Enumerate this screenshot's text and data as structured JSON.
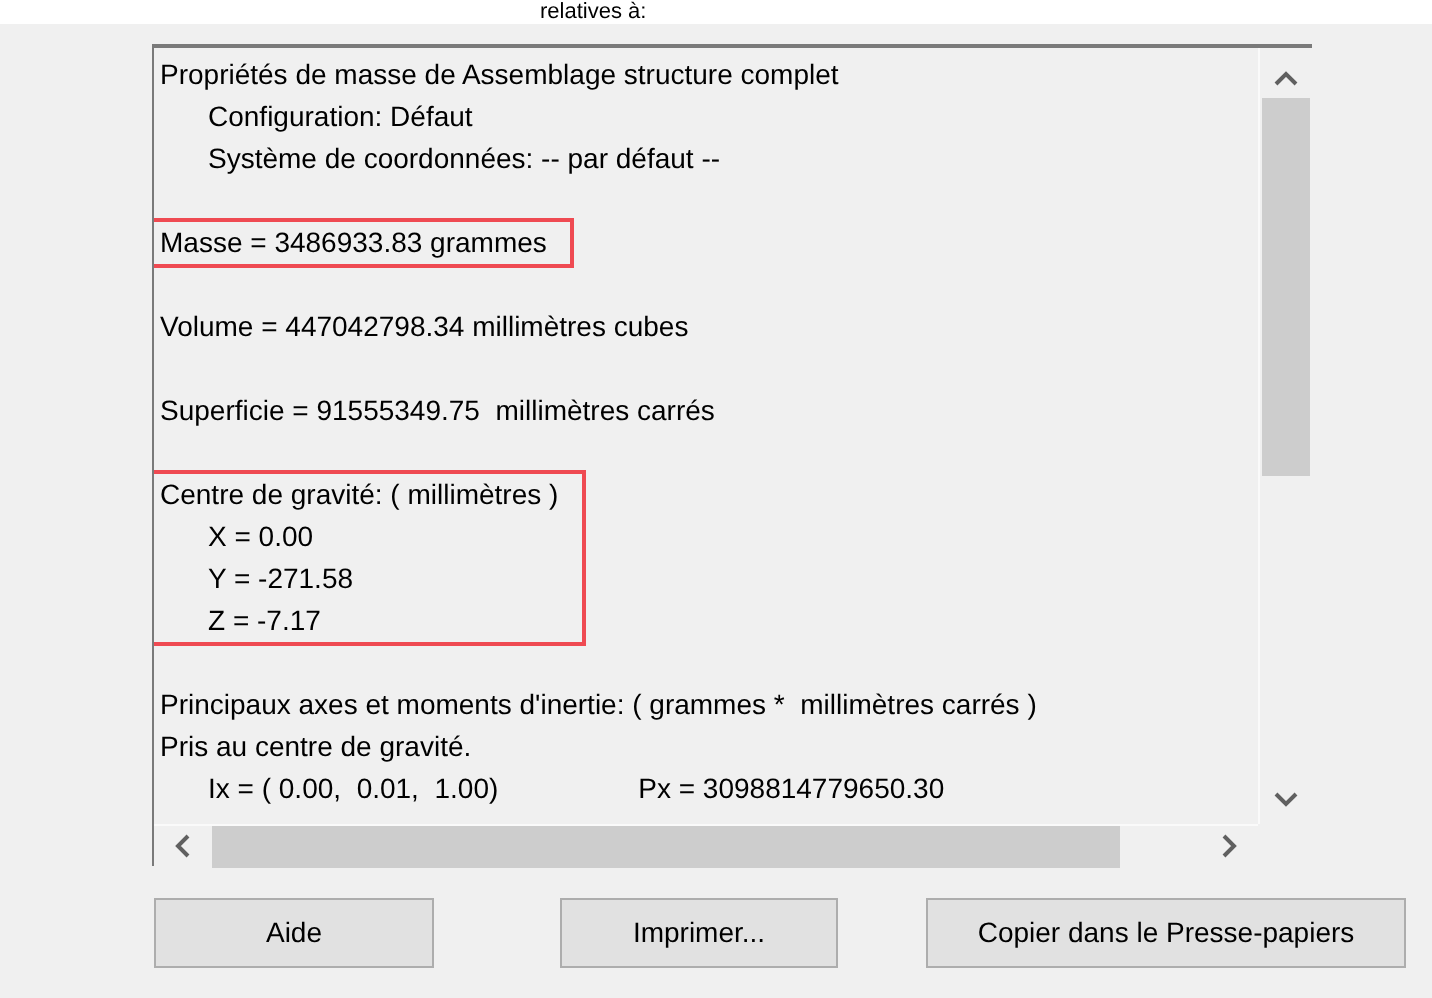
{
  "caption": "relatives à:",
  "report": {
    "sections": [
      {
        "highlighted": false,
        "lines": [
          {
            "text": "Propriétés de masse de Assemblage structure complet",
            "children": [
              {
                "cells": [
                  "Configuration: Défaut"
                ]
              },
              {
                "cells": [
                  "Système de coordonnées: -- par défaut --"
                ]
              }
            ]
          }
        ]
      },
      {
        "highlighted": true,
        "lines": [
          {
            "text": "Masse = 3486933.83 grammes"
          }
        ]
      },
      {
        "highlighted": false,
        "lines": [
          {
            "text": "Volume = 447042798.34 millimètres cubes"
          }
        ]
      },
      {
        "highlighted": false,
        "lines": [
          {
            "text": "Superficie = 91555349.75  millimètres carrés"
          }
        ]
      },
      {
        "highlighted": true,
        "lines": [
          {
            "text": "Centre de gravité: ( millimètres )",
            "children": [
              {
                "cells": [
                  "X = 0.00"
                ]
              },
              {
                "cells": [
                  "Y = -271.58"
                ]
              },
              {
                "cells": [
                  "Z = -7.17"
                ]
              }
            ]
          }
        ]
      },
      {
        "highlighted": false,
        "lines": [
          {
            "text": "Principaux axes et moments d'inertie: ( grammes *  millimètres carrés )"
          },
          {
            "text": "Pris au centre de gravité.",
            "children": [
              {
                "cells": [
                  "Ix = ( 0.00,  0.01,  1.00)",
                  "Px = 3098814779650.30"
                ]
              }
            ]
          }
        ]
      }
    ]
  },
  "buttons": [
    "Aide",
    "Imprimer...",
    "Copier dans le Presse-papiers"
  ]
}
